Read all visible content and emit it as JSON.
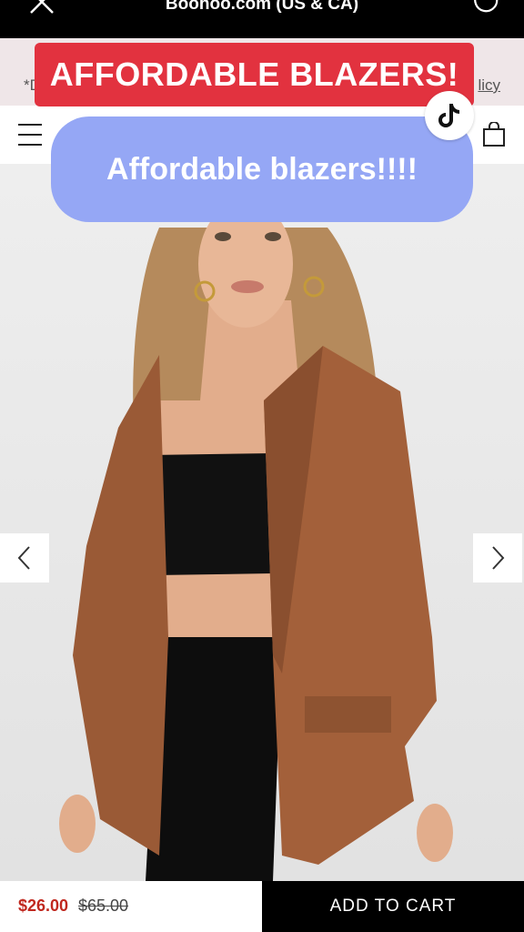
{
  "browser": {
    "url_title": "Boohoo.com (US & CA)",
    "close_icon": "close-icon",
    "reload_icon": "reload-icon"
  },
  "promo": {
    "left_text": "*D",
    "right_text": "licy"
  },
  "overlay": {
    "caption_red": "AFFORDABLE BLAZERS!",
    "caption_blue": "Affordable blazers!!!!",
    "red_color": "#e2323f",
    "blue_color": "#95a7f5"
  },
  "product": {
    "price_now": "$26.00",
    "price_was": "$65.00",
    "price_color": "#c0281f",
    "add_to_cart": "ADD TO CART"
  }
}
